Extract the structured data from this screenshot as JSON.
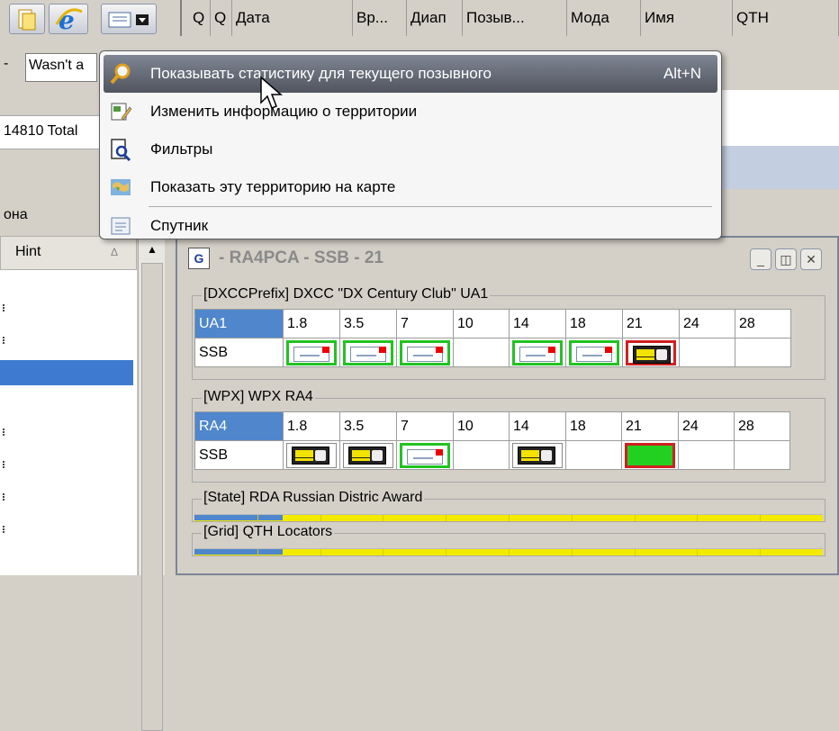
{
  "toolbar": {
    "buttons": [
      {
        "icon": "new-document-icon"
      },
      {
        "icon": "internet-explorer-icon"
      },
      {
        "icon": "view-dropdown-icon"
      }
    ]
  },
  "log_grid": {
    "columns": [
      "Q",
      "Q",
      "Дата",
      "Вр...",
      "Диап",
      "Позыв...",
      "Мода",
      "Имя",
      "QTH"
    ]
  },
  "left_panel": {
    "dash": "-",
    "input_value": "Wasn't a",
    "total_text": "14810 Total",
    "ona_label": "она",
    "hint_header": "Hint",
    "hint_sort_caret": "Δ",
    "scroll_up": "▲"
  },
  "context_menu": {
    "items": [
      {
        "label": "Показывать статистику для текущего позывного",
        "shortcut": "Alt+N",
        "icon": "stats-magnifier-icon",
        "active": true
      },
      {
        "label": "Изменить информацию о территории",
        "shortcut": "",
        "icon": "edit-territory-icon"
      },
      {
        "label": "Фильтры",
        "shortcut": "",
        "icon": "filter-icon"
      },
      {
        "label": "Показать эту территорию на карте",
        "shortcut": "",
        "icon": "map-icon"
      },
      {
        "label": "Спутник",
        "shortcut": "",
        "icon": "satellite-icon"
      }
    ]
  },
  "award_window": {
    "logo_text": "G",
    "title": "- RA4PCA - SSB - 21",
    "controls": {
      "minimize": "_",
      "restore": "◫",
      "close": "✕"
    },
    "groups": {
      "dxcc": {
        "title": "[DXCCPrefix] DXCC \"DX Century Club\" UA1",
        "header": "UA1",
        "bands": [
          "1.8",
          "3.5",
          "7",
          "10",
          "14",
          "18",
          "21",
          "24",
          "28"
        ],
        "mode": "SSB",
        "cells": [
          "qsl-green",
          "qsl-green",
          "qsl-green",
          "empty",
          "qsl-green",
          "qsl-green",
          "radio-red",
          "empty",
          "empty"
        ]
      },
      "wpx": {
        "title": "[WPX] WPX RA4",
        "header": "RA4",
        "bands": [
          "1.8",
          "3.5",
          "7",
          "10",
          "14",
          "18",
          "21",
          "24",
          "28"
        ],
        "mode": "SSB",
        "cells": [
          "radio",
          "radio",
          "qsl-green",
          "empty",
          "radio",
          "empty",
          "green-red",
          "empty",
          "empty"
        ]
      },
      "rda": {
        "title": "[State] RDA Russian Distric Award",
        "progress": 0.14
      },
      "grid": {
        "title": "[Grid] QTH Locators",
        "progress": 0.14
      }
    }
  },
  "colors": {
    "selection": "#4f86cc",
    "confirmed_border": "#22c322",
    "current_border": "#d02020",
    "progress_track": "#f4ea00"
  }
}
